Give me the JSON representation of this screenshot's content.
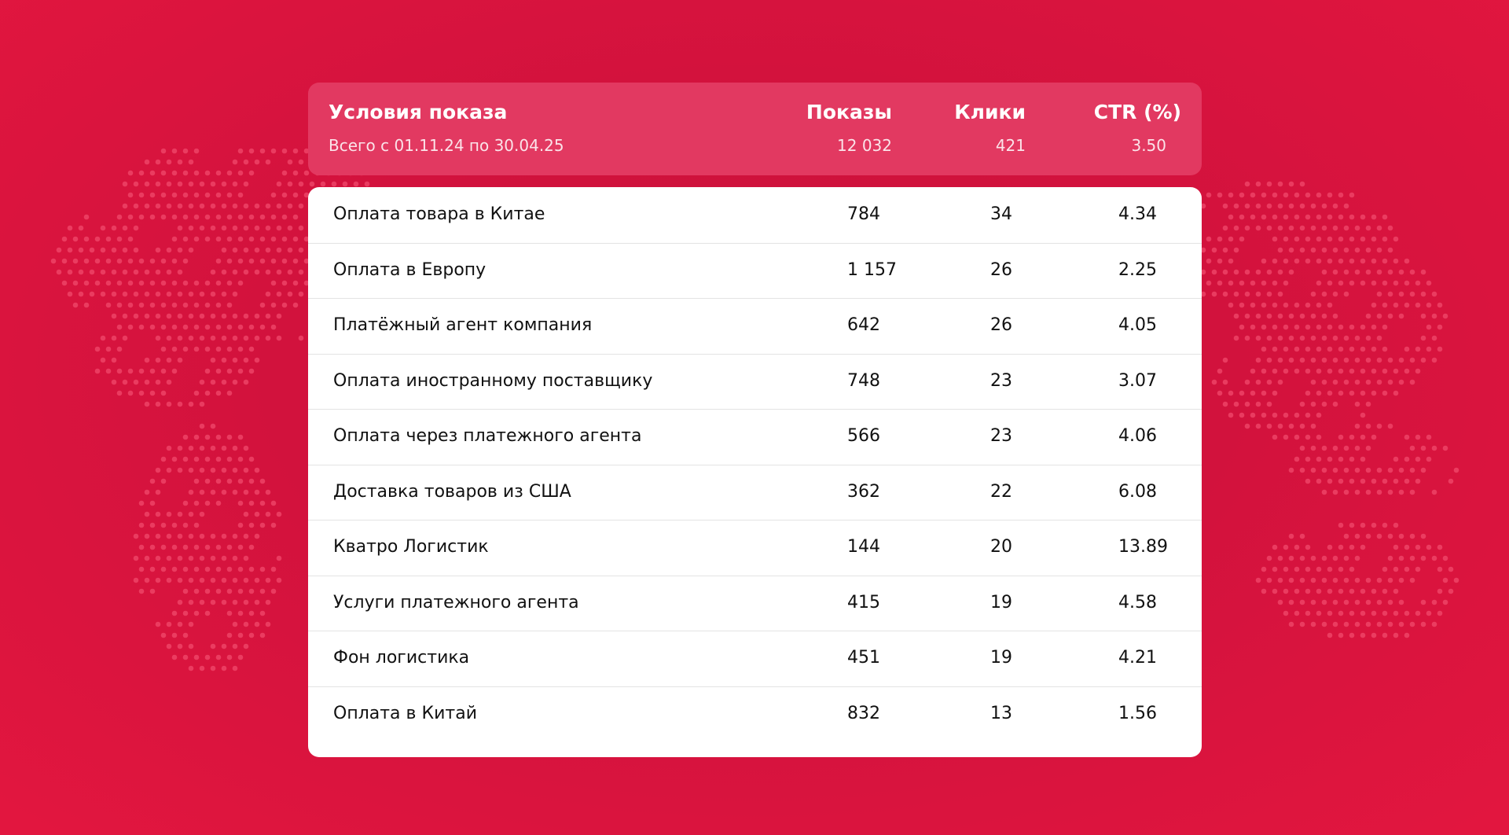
{
  "colors": {
    "background": "#d2123d",
    "summary_bg": "#e23961",
    "map_dots": "#f04a6c",
    "table_bg": "#ffffff"
  },
  "header": {
    "title": "Условия показа",
    "period": "Всего с 01.11.24 по 30.04.25",
    "col_shows": "Показы",
    "col_clicks": "Клики",
    "col_ctr": "CTR (%)",
    "total_shows": "12 032",
    "total_clicks": "421",
    "total_ctr": "3.50"
  },
  "rows": [
    {
      "name": "Оплата товара в Китае",
      "shows": "784",
      "clicks": "34",
      "ctr": "4.34"
    },
    {
      "name": "Оплата в Европу",
      "shows": "1 157",
      "clicks": "26",
      "ctr": "2.25"
    },
    {
      "name": "Платёжный агент компания",
      "shows": "642",
      "clicks": "26",
      "ctr": "4.05"
    },
    {
      "name": "Оплата иностранному поставщику",
      "shows": "748",
      "clicks": "23",
      "ctr": "3.07"
    },
    {
      "name": "Оплата через платежного агента",
      "shows": "566",
      "clicks": "23",
      "ctr": "4.06"
    },
    {
      "name": "Доставка товаров из США",
      "shows": "362",
      "clicks": "22",
      "ctr": "6.08"
    },
    {
      "name": "Кватро Логистик",
      "shows": "144",
      "clicks": "20",
      "ctr": "13.89"
    },
    {
      "name": "Услуги платежного агента",
      "shows": "415",
      "clicks": "19",
      "ctr": "4.58"
    },
    {
      "name": "Фон логистика",
      "shows": "451",
      "clicks": "19",
      "ctr": "4.21"
    },
    {
      "name": "Оплата в Китай",
      "shows": "832",
      "clicks": "13",
      "ctr": "1.56"
    }
  ],
  "chart_data": {
    "type": "table",
    "columns": [
      "Условия показа",
      "Показы",
      "Клики",
      "CTR (%)"
    ],
    "totals": {
      "label": "Всего с 01.11.24 по 30.04.25",
      "shows": 12032,
      "clicks": 421,
      "ctr": 3.5
    },
    "rows": [
      [
        "Оплата товара в Китае",
        784,
        34,
        4.34
      ],
      [
        "Оплата в Европу",
        1157,
        26,
        2.25
      ],
      [
        "Платёжный агент компания",
        642,
        26,
        4.05
      ],
      [
        "Оплата иностранному поставщику",
        748,
        23,
        3.07
      ],
      [
        "Оплата через платежного агента",
        566,
        23,
        4.06
      ],
      [
        "Доставка товаров из США",
        362,
        22,
        6.08
      ],
      [
        "Кватро Логистик",
        144,
        20,
        13.89
      ],
      [
        "Услуги платежного агента",
        415,
        19,
        4.58
      ],
      [
        "Фон логистика",
        451,
        19,
        4.21
      ],
      [
        "Оплата в Китай",
        832,
        13,
        1.56
      ]
    ]
  }
}
